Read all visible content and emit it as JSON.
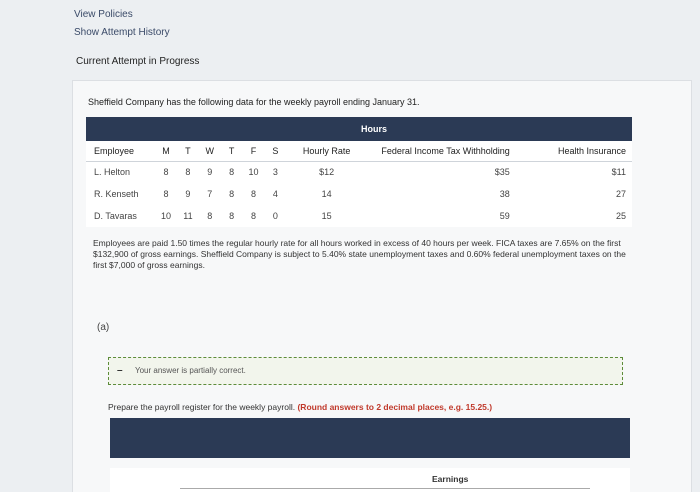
{
  "links": {
    "view_policies": "View Policies",
    "show_attempt_history": "Show Attempt History"
  },
  "section_heading": "Current Attempt in Progress",
  "intro": "Sheffield Company has the following data for the weekly payroll ending January 31.",
  "table": {
    "group_header": "Hours",
    "columns": [
      "Employee",
      "M",
      "T",
      "W",
      "T",
      "F",
      "S",
      "Hourly Rate",
      "Federal Income Tax Withholding",
      "Health Insurance"
    ],
    "rows": [
      [
        "L. Helton",
        "8",
        "8",
        "9",
        "8",
        "10",
        "3",
        "$12",
        "$35",
        "$11"
      ],
      [
        "R. Kenseth",
        "8",
        "9",
        "7",
        "8",
        "8",
        "4",
        "14",
        "38",
        "27"
      ],
      [
        "D. Tavaras",
        "10",
        "11",
        "8",
        "8",
        "8",
        "0",
        "15",
        "59",
        "25"
      ]
    ]
  },
  "note": "Employees are paid 1.50 times the regular hourly rate for all hours worked in excess of 40 hours per week. FICA taxes are 7.65% on the first $132,900 of gross earnings. Sheffield Company is subject to 5.40% state unemployment taxes and 0.60% federal unemployment taxes on the first $7,000 of gross earnings.",
  "part_label": "(a)",
  "status": {
    "icon": "minus-icon",
    "text": "Your answer is partially correct."
  },
  "instruction": {
    "text": "Prepare the payroll register for the weekly payroll.",
    "emphasis": "(Round answers to 2 decimal places, e.g. 15.25.)"
  },
  "register": {
    "earnings_header": "Earnings"
  },
  "colors": {
    "header_bar": "#2b3a55",
    "status_border": "#5d8c3a",
    "emphasis": "#c0392b"
  }
}
